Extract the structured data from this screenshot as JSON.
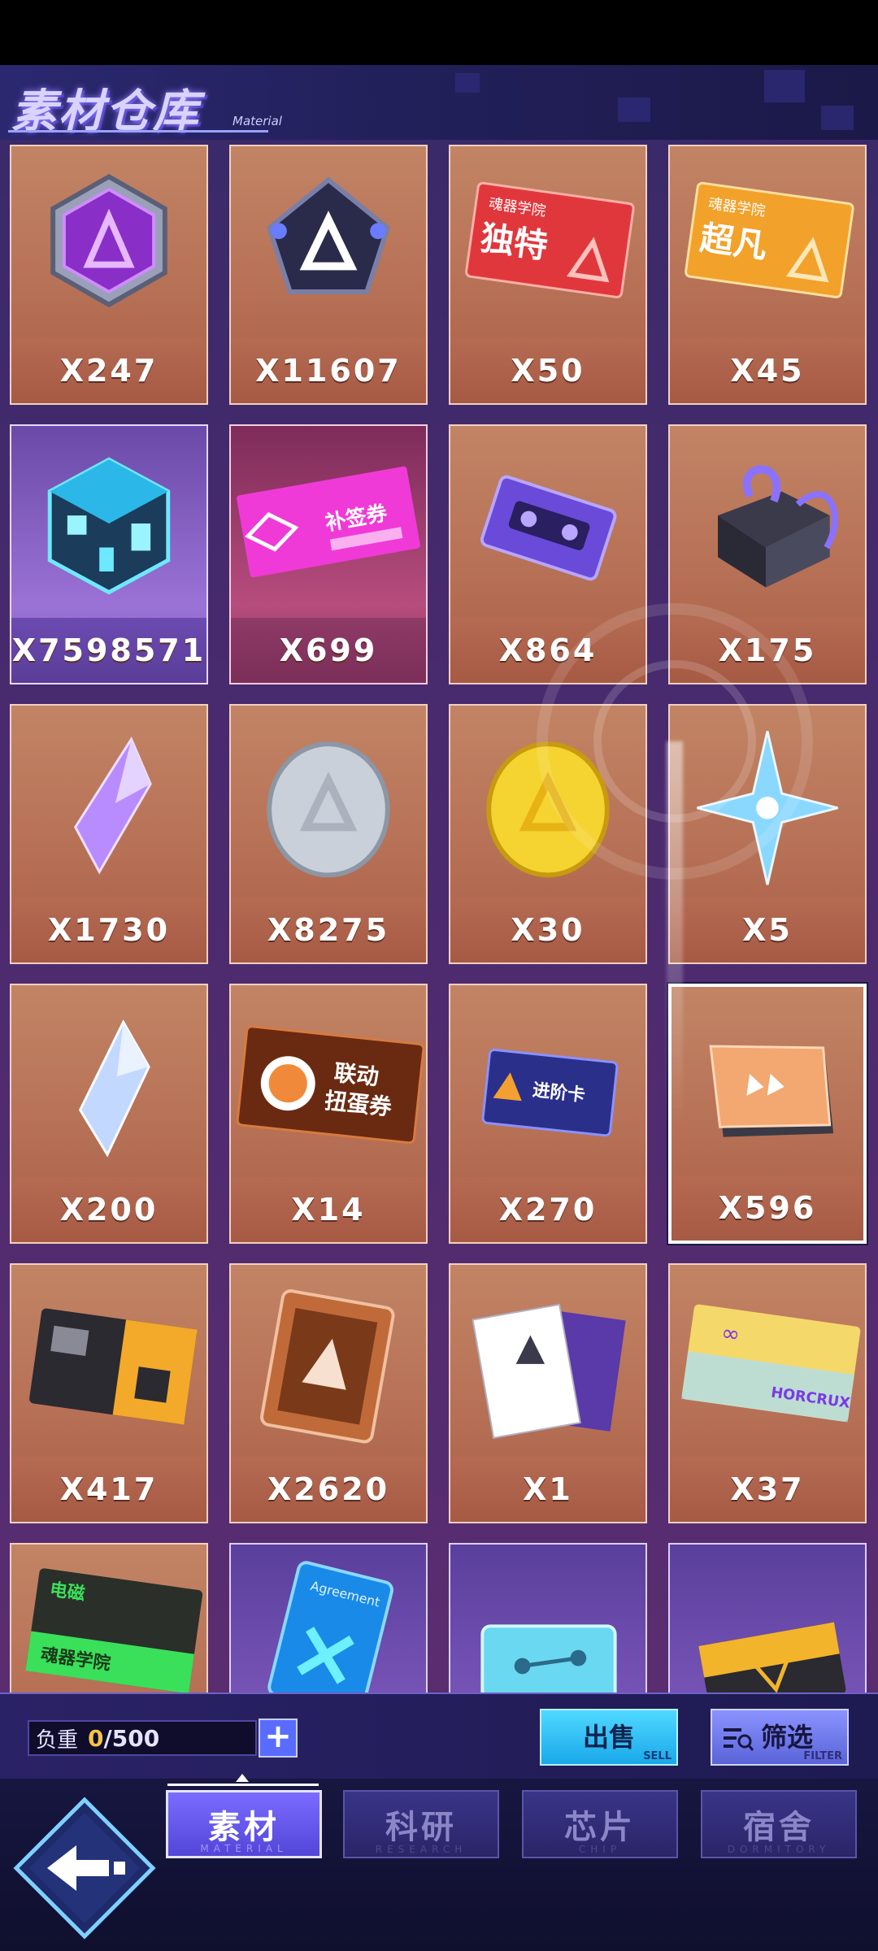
{
  "header": {
    "title": "素材仓库",
    "subtitle": "Material"
  },
  "items": [
    {
      "qty": "X247"
    },
    {
      "qty": "X11607"
    },
    {
      "qty": "X50"
    },
    {
      "qty": "X45"
    },
    {
      "qty": "X7598571"
    },
    {
      "qty": "X699"
    },
    {
      "qty": "X864"
    },
    {
      "qty": "X175"
    },
    {
      "qty": "X1730"
    },
    {
      "qty": "X8275"
    },
    {
      "qty": "X30"
    },
    {
      "qty": "X5"
    },
    {
      "qty": "X200"
    },
    {
      "qty": "X14"
    },
    {
      "qty": "X270"
    },
    {
      "qty": "X596"
    },
    {
      "qty": "X417"
    },
    {
      "qty": "X2620"
    },
    {
      "qty": "X1"
    },
    {
      "qty": "X37"
    },
    {
      "qty": ""
    },
    {
      "qty": ""
    },
    {
      "qty": ""
    },
    {
      "qty": ""
    }
  ],
  "item_texts": {
    "ticket_unique_school": "魂器学院",
    "ticket_unique_name": "独特",
    "ticket_super_school": "魂器学院",
    "ticket_super_name": "超凡",
    "makeup_ticket": "补签券",
    "collab_ticket_line1": "联动",
    "collab_ticket_line2": "扭蛋券",
    "advance_card": "进阶卡",
    "horcrux_card": "HORCRUX",
    "em_card_title": "电磁",
    "em_card_school": "魂器学院",
    "agreement_card": "Agreement"
  },
  "bottom_bar": {
    "weight_label": "负重",
    "weight_current": "0",
    "weight_max": "/500",
    "sell_label": "出售",
    "sell_sub": "SELL",
    "filter_label": "筛选",
    "filter_sub": "FILTER"
  },
  "tabs": [
    {
      "label": "素材",
      "sub": "MATERIAL",
      "active": true
    },
    {
      "label": "科研",
      "sub": "RESEARCH",
      "active": false
    },
    {
      "label": "芯片",
      "sub": "CHIP",
      "active": false
    },
    {
      "label": "宿舍",
      "sub": "DORMITORY",
      "active": false
    }
  ],
  "colors": {
    "accent": "#7a6cff",
    "sell": "#1aa8ea",
    "weight_current": "#f3c445",
    "card_bg": "#b77156"
  }
}
